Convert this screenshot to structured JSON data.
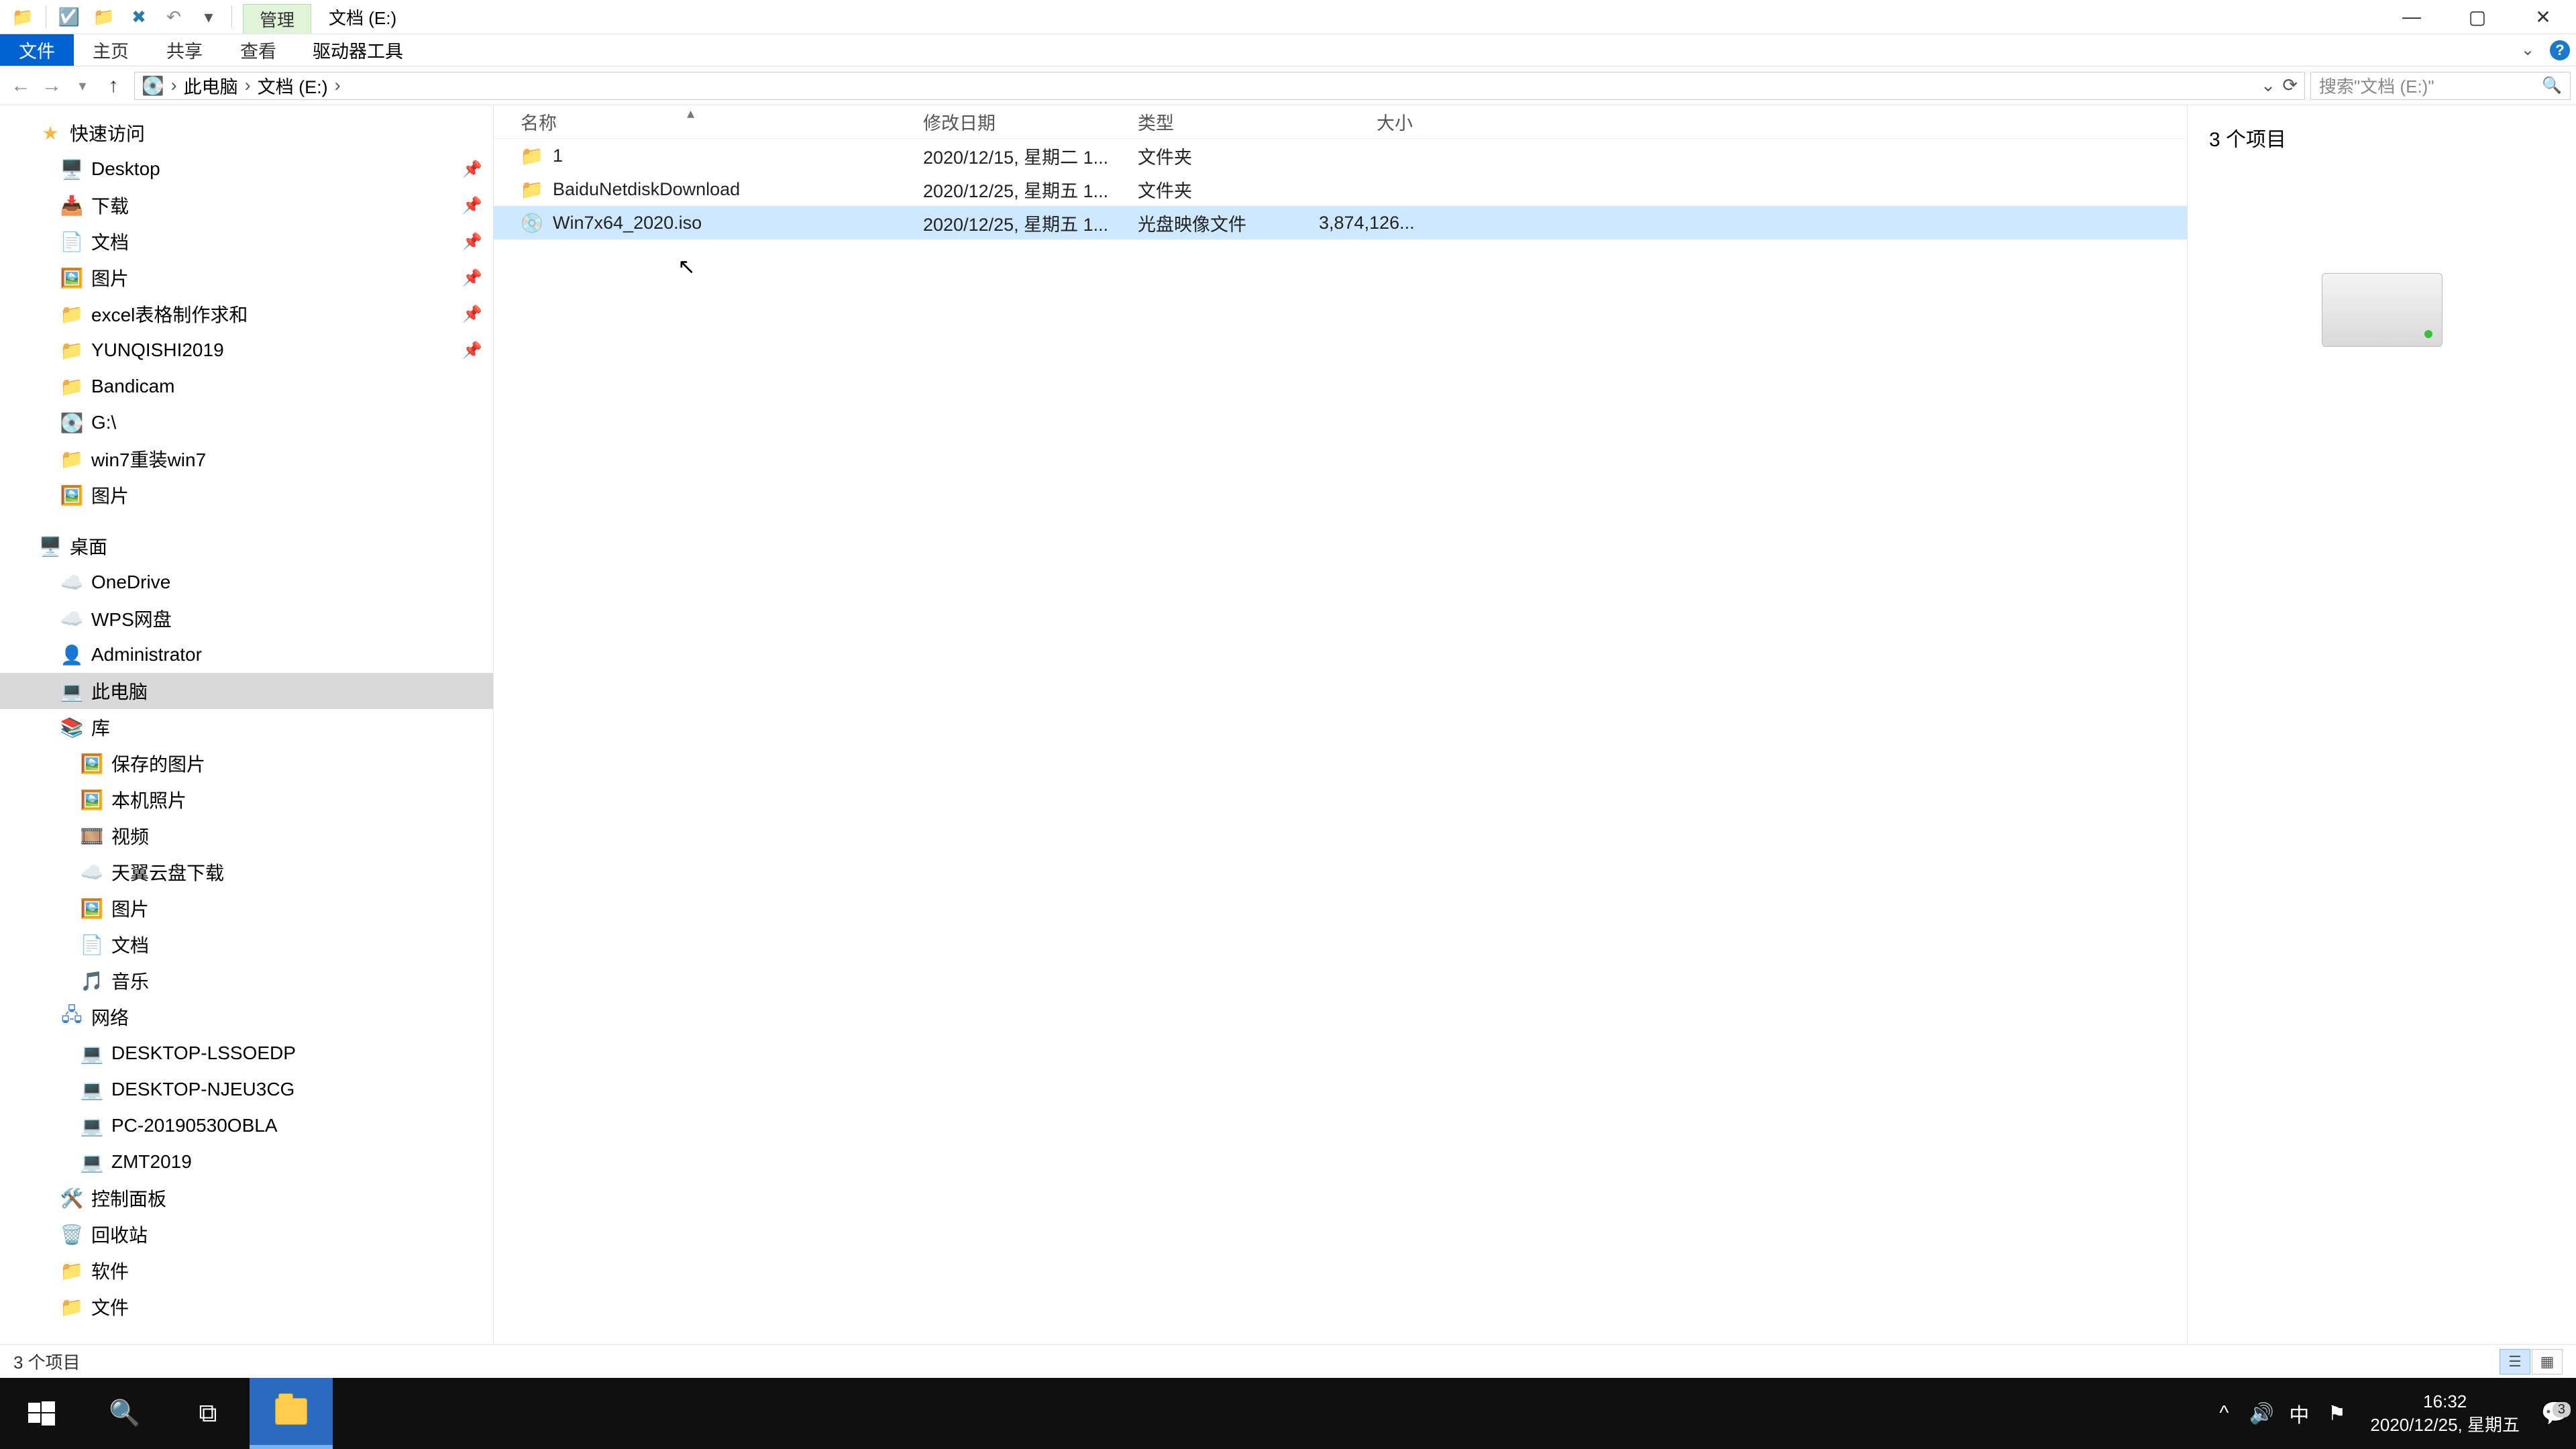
{
  "window": {
    "context_tab": "管理",
    "title": "文档 (E:)"
  },
  "ribbon": {
    "file": "文件",
    "home": "主页",
    "share": "共享",
    "view": "查看",
    "drivetools": "驱动器工具"
  },
  "address": {
    "root": "此电脑",
    "current": "文档 (E:)"
  },
  "search": {
    "placeholder": "搜索\"文档 (E:)\""
  },
  "tree": {
    "quick_access": "快速访问",
    "quick_items": [
      {
        "label": "Desktop",
        "icon": "🖥️",
        "pin": true
      },
      {
        "label": "下载",
        "icon": "📥",
        "pin": true
      },
      {
        "label": "文档",
        "icon": "📄",
        "pin": true
      },
      {
        "label": "图片",
        "icon": "🖼️",
        "pin": true
      },
      {
        "label": "excel表格制作求和",
        "icon": "📁",
        "pin": true
      },
      {
        "label": "YUNQISHI2019",
        "icon": "📁",
        "pin": true
      },
      {
        "label": "Bandicam",
        "icon": "📁",
        "pin": false
      },
      {
        "label": "G:\\",
        "icon": "💽",
        "pin": false
      },
      {
        "label": "win7重装win7",
        "icon": "📁",
        "pin": false
      },
      {
        "label": "图片",
        "icon": "🖼️",
        "pin": false
      }
    ],
    "desktop": "桌面",
    "desktop_items": [
      {
        "label": "OneDrive",
        "icon": "☁️"
      },
      {
        "label": "WPS网盘",
        "icon": "☁️"
      },
      {
        "label": "Administrator",
        "icon": "👤"
      }
    ],
    "this_pc": "此电脑",
    "libraries": "库",
    "lib_items": [
      {
        "label": "保存的图片",
        "icon": "🖼️"
      },
      {
        "label": "本机照片",
        "icon": "🖼️"
      },
      {
        "label": "视频",
        "icon": "🎞️"
      },
      {
        "label": "天翼云盘下载",
        "icon": "☁️"
      },
      {
        "label": "图片",
        "icon": "🖼️"
      },
      {
        "label": "文档",
        "icon": "📄"
      },
      {
        "label": "音乐",
        "icon": "🎵"
      }
    ],
    "network": "网络",
    "net_items": [
      {
        "label": "DESKTOP-LSSOEDP"
      },
      {
        "label": "DESKTOP-NJEU3CG"
      },
      {
        "label": "PC-20190530OBLA"
      },
      {
        "label": "ZMT2019"
      }
    ],
    "control_panel": "控制面板",
    "recycle": "回收站",
    "software": "软件",
    "docs_folder": "文件"
  },
  "columns": {
    "name": "名称",
    "date": "修改日期",
    "type": "类型",
    "size": "大小"
  },
  "rows": [
    {
      "name": "1",
      "date": "2020/12/15, 星期二 1...",
      "type": "文件夹",
      "size": "",
      "icon": "📁",
      "selected": false
    },
    {
      "name": "BaiduNetdiskDownload",
      "date": "2020/12/25, 星期五 1...",
      "type": "文件夹",
      "size": "",
      "icon": "📁",
      "selected": false
    },
    {
      "name": "Win7x64_2020.iso",
      "date": "2020/12/25, 星期五 1...",
      "type": "光盘映像文件",
      "size": "3,874,126...",
      "icon": "💿",
      "selected": true
    }
  ],
  "preview": {
    "heading": "3 个项目"
  },
  "status": {
    "text": "3 个项目"
  },
  "taskbar": {
    "time": "16:32",
    "date": "2020/12/25, 星期五",
    "ime": "中",
    "notif_count": "3"
  }
}
